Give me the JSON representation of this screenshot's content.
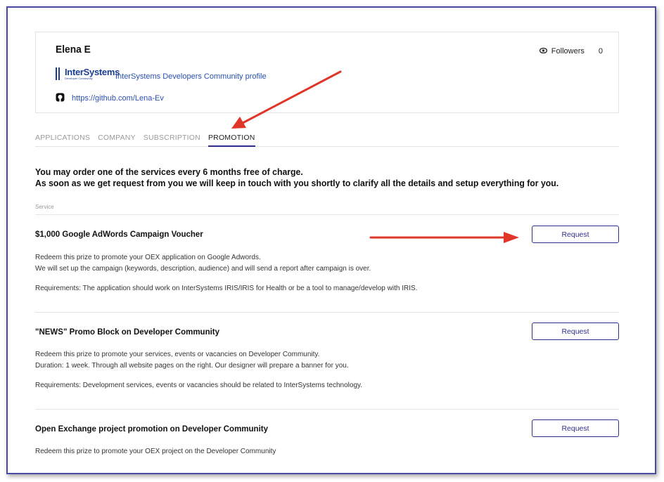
{
  "profile": {
    "name": "Elena E",
    "followers_label": "Followers",
    "followers_count": "0",
    "logo_text": "InterSystems",
    "logo_subtext": "Developer Community",
    "community_link": "InterSystems Developers Community profile",
    "github_url": "https://github.com/Lena-Ev"
  },
  "tabs": [
    {
      "label": "APPLICATIONS",
      "active": false
    },
    {
      "label": "COMPANY",
      "active": false
    },
    {
      "label": "SUBSCRIPTION",
      "active": false
    },
    {
      "label": "PROMOTION",
      "active": true
    }
  ],
  "intro": {
    "line1": "You may order one of the services every 6 months free of charge.",
    "line2": "As soon as we get request from you we will keep in touch with you shortly to clarify all the details and setup everything for you."
  },
  "services_header": "Service",
  "services": [
    {
      "title": "$1,000 Google AdWords Campaign Voucher",
      "desc1": "Redeem this prize to promote your OEX application on Google Adwords.",
      "desc2": "We will set up the campaign (keywords, description, audience) and will send a report after campaign is over.",
      "requirements": "Requirements: The application should work on InterSystems IRIS/IRIS for Health or be a tool to manage/develop with IRIS.",
      "button": "Request"
    },
    {
      "title": "\"NEWS\" Promo Block on Developer Community",
      "desc1": "Redeem this prize to promote your services, events or vacancies on Developer Community.",
      "desc2": "Duration: 1 week. Through all website pages on the right. Our designer will prepare a banner for you.",
      "requirements": "Requirements: Development services, events or vacancies should be related to InterSystems technology.",
      "button": "Request"
    },
    {
      "title": "Open Exchange project promotion on Developer Community",
      "desc1": "Redeem this prize to promote your OEX project on the Developer Community",
      "button": "Request"
    }
  ],
  "colors": {
    "accent": "#2e2e8a",
    "link": "#2a4fb0",
    "annotation_arrow": "#e0362a",
    "frame_border": "#4a4aa5"
  }
}
